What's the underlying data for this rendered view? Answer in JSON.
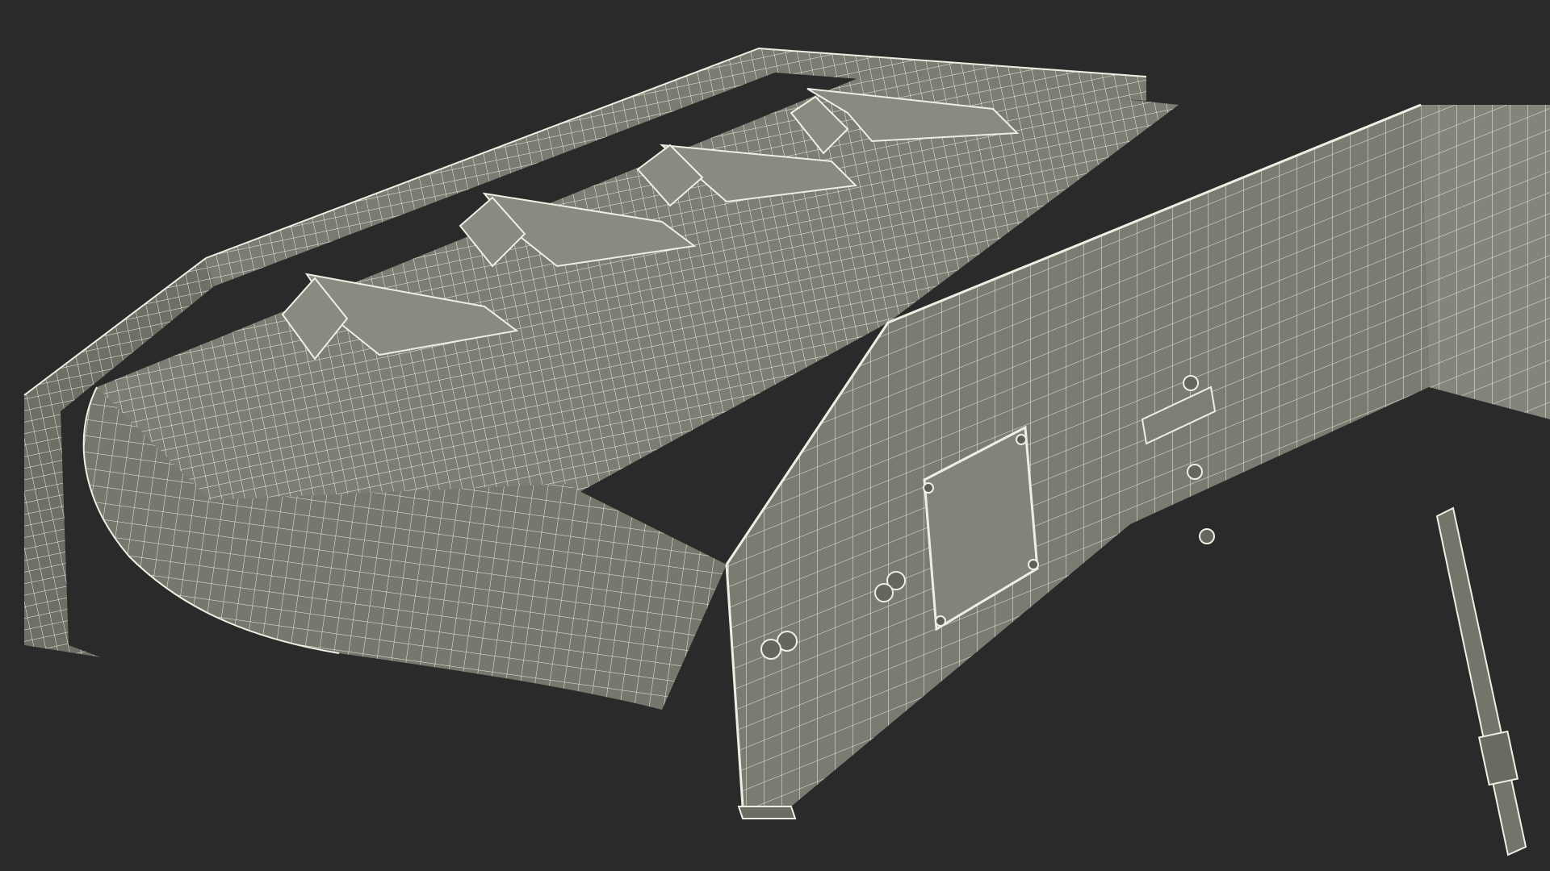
{
  "scene": {
    "background_color": "#2a2a2a",
    "surface_color": "#7b7b71",
    "surface_light_color": "#8a8a80",
    "surface_dark_color": "#5f5f57",
    "wire_color": "#efeee2"
  }
}
